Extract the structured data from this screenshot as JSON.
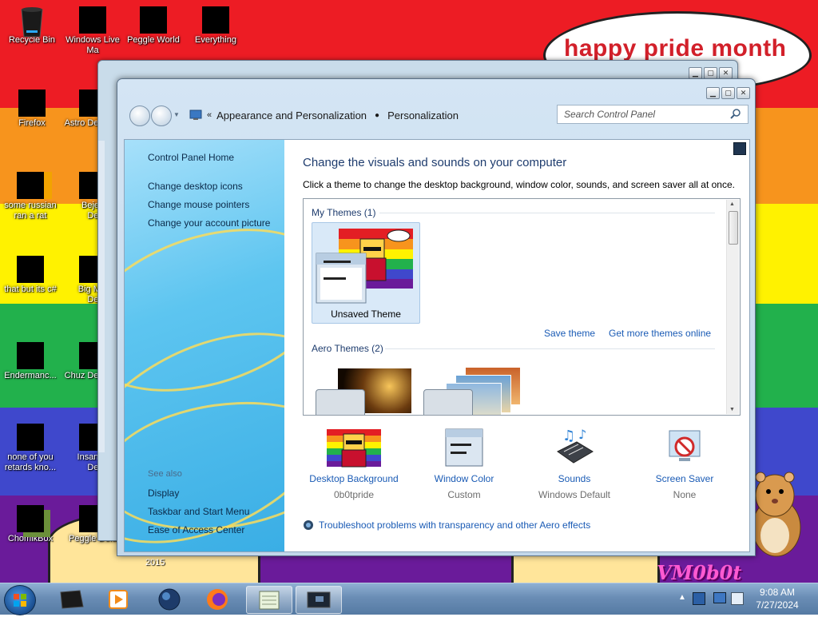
{
  "desktop": {
    "bubble_text": "happy pride month",
    "corner_text": "VM0b0t",
    "icons": [
      {
        "label": "Recycle Bin"
      },
      {
        "label": "Windows Live Ma"
      },
      {
        "label": "Peggle World"
      },
      {
        "label": "Everything"
      },
      {
        "label": "Firefox"
      },
      {
        "label": "Astro Delu"
      },
      {
        "label": "some russian ran a rat"
      },
      {
        "label": "Bejew Delu"
      },
      {
        "label": "that but its c#"
      },
      {
        "label": "Big Mo Delu"
      },
      {
        "label": "Endermanc..."
      },
      {
        "label": "Chuz Delu"
      },
      {
        "label": "none of you retards kno..."
      },
      {
        "label": "Insaniq Delu"
      },
      {
        "label": "ChomikBox"
      },
      {
        "label": "Peggle Delu"
      }
    ],
    "partial_text": "2015"
  },
  "window": {
    "breadcrumb": {
      "root": "Appearance and Personalization",
      "current": "Personalization"
    },
    "search_placeholder": "Search Control Panel",
    "sidebar": {
      "home": "Control Panel Home",
      "links": [
        "Change desktop icons",
        "Change mouse pointers",
        "Change your account picture"
      ],
      "see_also_label": "See also",
      "see_also": [
        "Display",
        "Taskbar and Start Menu",
        "Ease of Access Center"
      ]
    },
    "main": {
      "title": "Change the visuals and sounds on your computer",
      "description": "Click a theme to change the desktop background, window color, sounds, and screen saver all at once.",
      "my_themes_header": "My Themes (1)",
      "selected_theme": "Unsaved Theme",
      "save_theme": "Save theme",
      "get_more_themes": "Get more themes online",
      "aero_themes_header": "Aero Themes (2)"
    },
    "bottom": [
      {
        "label": "Desktop Background",
        "value": "0b0tpride"
      },
      {
        "label": "Window Color",
        "value": "Custom"
      },
      {
        "label": "Sounds",
        "value": "Windows Default"
      },
      {
        "label": "Screen Saver",
        "value": "None"
      }
    ],
    "troubleshoot": "Troubleshoot problems with transparency and other Aero effects"
  },
  "taskbar": {
    "time": "9:08 AM",
    "date": "7/27/2024"
  }
}
